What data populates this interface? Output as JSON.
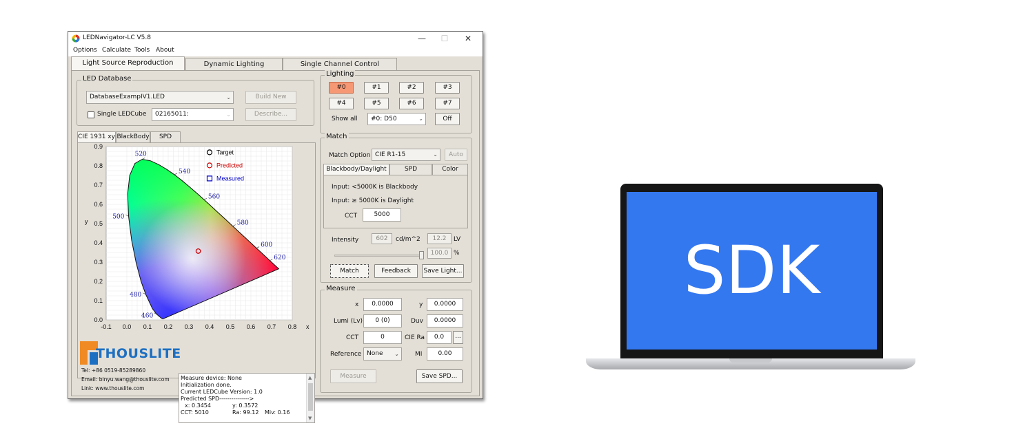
{
  "window": {
    "title": "LEDNavigator-LC V5.8",
    "controls": [
      "—",
      "☐",
      "✕"
    ]
  },
  "menu": [
    "Options",
    "Calculate",
    "Tools",
    "About"
  ],
  "main_tabs": [
    "Light Source Reproduction",
    "Dynamic Lighting",
    "Single Channel Control"
  ],
  "led_database": {
    "title": "LED Database",
    "database_value": "DatabaseExampIV1.LED",
    "build_new": "Build New",
    "single_ledcube": "Single LEDCube",
    "cube_value": "02165011:",
    "describe": "Describe..."
  },
  "chart_tabs": [
    "CIE 1931 xy",
    "BlackBody",
    "SPD"
  ],
  "chart_data": {
    "type": "scatter",
    "title": "",
    "xlabel": "x",
    "ylabel": "y",
    "xlim": [
      -0.1,
      0.8
    ],
    "ylim": [
      0.0,
      0.9
    ],
    "x_ticks": [
      "-0.1",
      "0.0",
      "0.1",
      "0.2",
      "0.3",
      "0.4",
      "0.5",
      "0.6",
      "0.7",
      "0.8"
    ],
    "y_ticks": [
      "0.0",
      "0.1",
      "0.2",
      "0.3",
      "0.4",
      "0.5",
      "0.6",
      "0.7",
      "0.8",
      "0.9"
    ],
    "wavelength_labels": [
      {
        "nm": "460",
        "x": 0.144,
        "y": 0.03
      },
      {
        "nm": "480",
        "x": 0.091,
        "y": 0.133
      },
      {
        "nm": "500",
        "x": 0.008,
        "y": 0.538
      },
      {
        "nm": "520",
        "x": 0.074,
        "y": 0.834
      },
      {
        "nm": "540",
        "x": 0.23,
        "y": 0.754
      },
      {
        "nm": "560",
        "x": 0.373,
        "y": 0.624
      },
      {
        "nm": "580",
        "x": 0.512,
        "y": 0.487
      },
      {
        "nm": "600",
        "x": 0.627,
        "y": 0.373
      },
      {
        "nm": "620",
        "x": 0.691,
        "y": 0.308
      }
    ],
    "series": [
      {
        "name": "Target",
        "marker": "circle",
        "color": "#000000",
        "points": []
      },
      {
        "name": "Predicted",
        "marker": "circle",
        "color": "#cc0000",
        "points": [
          {
            "x": 0.3454,
            "y": 0.3572
          }
        ]
      },
      {
        "name": "Measured",
        "marker": "square",
        "color": "#0000cc",
        "points": []
      }
    ],
    "legend_position": "top-right",
    "grid": true
  },
  "lighting": {
    "title": "Lighting",
    "buttons": [
      "#0",
      "#1",
      "#2",
      "#3",
      "#4",
      "#5",
      "#6",
      "#7"
    ],
    "selected_index": 0,
    "show_all": "Show all",
    "preset_value": "#0: D50",
    "off": "Off"
  },
  "match": {
    "title": "Match",
    "match_option_label": "Match Option",
    "match_option_value": "CIE R1-15",
    "auto": "Auto",
    "tabs": [
      "Blackbody/Daylight",
      "SPD",
      "Color"
    ],
    "input_line1": "Input: <5000K is Blackbody",
    "input_line2": "Input: ≥ 5000K is Daylight",
    "cct_label": "CCT",
    "cct_value": "5000",
    "intensity_label": "Intensity",
    "intensity_value": "602",
    "intensity_unit": "cd/m^2",
    "lv_value": "12.2",
    "lv_unit": "LV",
    "slider_percent_value": "100.0",
    "slider_fraction": 1.0,
    "percent_unit": "%",
    "match_btn": "Match",
    "feedback_btn": "Feedback",
    "save_light_btn": "Save Light..."
  },
  "measure": {
    "title": "Measure",
    "x_label": "x",
    "x_value": "0.0000",
    "y_label": "y",
    "y_value": "0.0000",
    "lumi_label": "Lumi (Lv)",
    "lumi_value": "0 (0)",
    "duv_label": "Duv",
    "duv_value": "0.0000",
    "cct_label": "CCT",
    "cct_value": "0",
    "ra_label": "CIE Ra",
    "ra_value": "0.0",
    "ra_more": "...",
    "reference_label": "Reference",
    "reference_value": "None",
    "mi_label": "MI",
    "mi_value": "0.00",
    "measure_btn": "Measure",
    "save_spd_btn": "Save SPD..."
  },
  "brand": {
    "logo_text": "THOUSLITE",
    "tel": "Tel: +86 0519-85289860",
    "email": "Email: binyu.wang@thouslite.com",
    "link": "Link: www.thouslite.com"
  },
  "log": {
    "line1": "Measure device:   None",
    "line2": "Initialization done.",
    "line3": "Current LEDCube Version: 1.0",
    "line4": "Predicted SPD--------------->",
    "line5a": "x: 0.3454",
    "line5b": "y: 0.3572",
    "line6a": "CCT: 5010",
    "line6b": "Ra: 99.12",
    "line6c": "Miv: 0.16"
  },
  "laptop": {
    "screen_text": "SDK",
    "screen_color": "#3478f0"
  },
  "colors": {
    "window_bg": "#e3dfd7",
    "selected_button": "#f79874",
    "logo_orange": "#f08a24",
    "logo_blue": "#1d6fc2",
    "wavelength_label": "#1a1aa6"
  }
}
